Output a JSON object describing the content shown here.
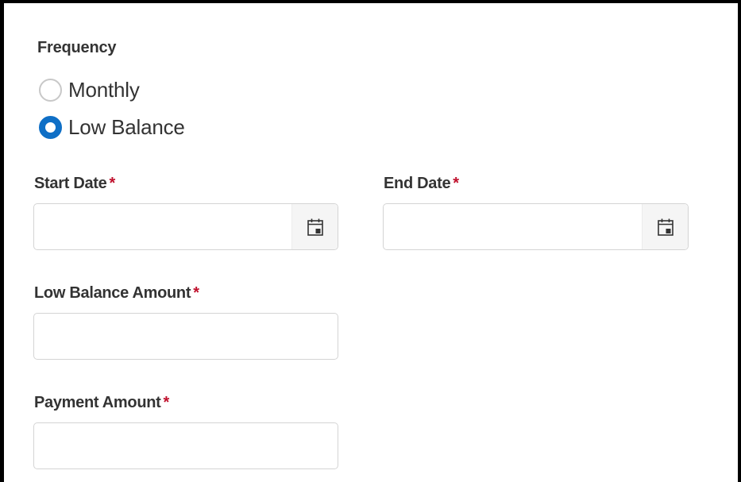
{
  "frequency": {
    "label": "Frequency",
    "options": [
      {
        "label": "Monthly",
        "selected": false
      },
      {
        "label": "Low Balance",
        "selected": true
      }
    ]
  },
  "fields": {
    "start_date": {
      "label": "Start Date",
      "required_mark": "*",
      "value": "",
      "icon": "calendar-icon"
    },
    "end_date": {
      "label": "End Date",
      "required_mark": "*",
      "value": "",
      "icon": "calendar-icon"
    },
    "low_balance_amount": {
      "label": "Low Balance Amount",
      "required_mark": "*",
      "value": ""
    },
    "payment_amount": {
      "label": "Payment Amount",
      "required_mark": "*",
      "value": ""
    }
  },
  "colors": {
    "accent": "#0f6fc6",
    "required": "#c0102c",
    "text": "#333333",
    "border": "#d4d4d4"
  }
}
